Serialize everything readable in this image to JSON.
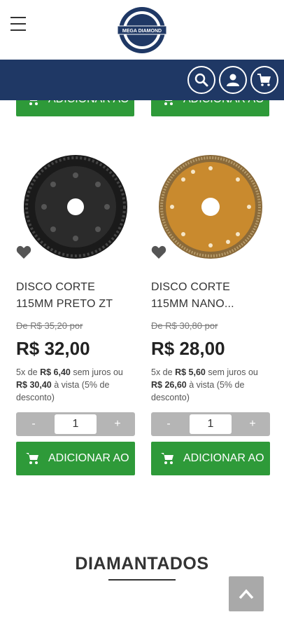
{
  "header": {
    "menu_icon": "hamburger-icon",
    "logo_text": "MEGA DIAMOND",
    "nav_icons": [
      "search-icon",
      "user-icon",
      "cart-icon"
    ],
    "nav_color": "#1f3865"
  },
  "add_to_cart_label": "ADICIONAR AO",
  "products": [
    {
      "name": "DISCO CORTE 115MM PRETO ZT",
      "old_price": "De R$ 35,20 por",
      "price": "R$ 32,00",
      "install_prefix": "5x de ",
      "install_value": "R$ 6,40",
      "install_suffix": " sem juros ou ",
      "cash_value": "R$ 30,40",
      "cash_suffix": " à vista (5% de desconto)",
      "qty_minus": "-",
      "qty_value": "1",
      "qty_plus": "+",
      "disc_color": "#2b2b2b"
    },
    {
      "name": "DISCO CORTE 115MM NANO...",
      "old_price": "De R$ 30,80 por",
      "price": "R$ 28,00",
      "install_prefix": "5x de ",
      "install_value": "R$ 5,60",
      "install_suffix": " sem juros ou ",
      "cash_value": "R$ 26,60",
      "cash_suffix": " à vista (5% de desconto)",
      "qty_minus": "-",
      "qty_value": "1",
      "qty_plus": "+",
      "disc_color": "#c98a2e"
    }
  ],
  "section": {
    "title": "DIAMANTADOS"
  },
  "colors": {
    "accent_green": "#2e9a39",
    "qty_gray": "#b5b5b5"
  }
}
